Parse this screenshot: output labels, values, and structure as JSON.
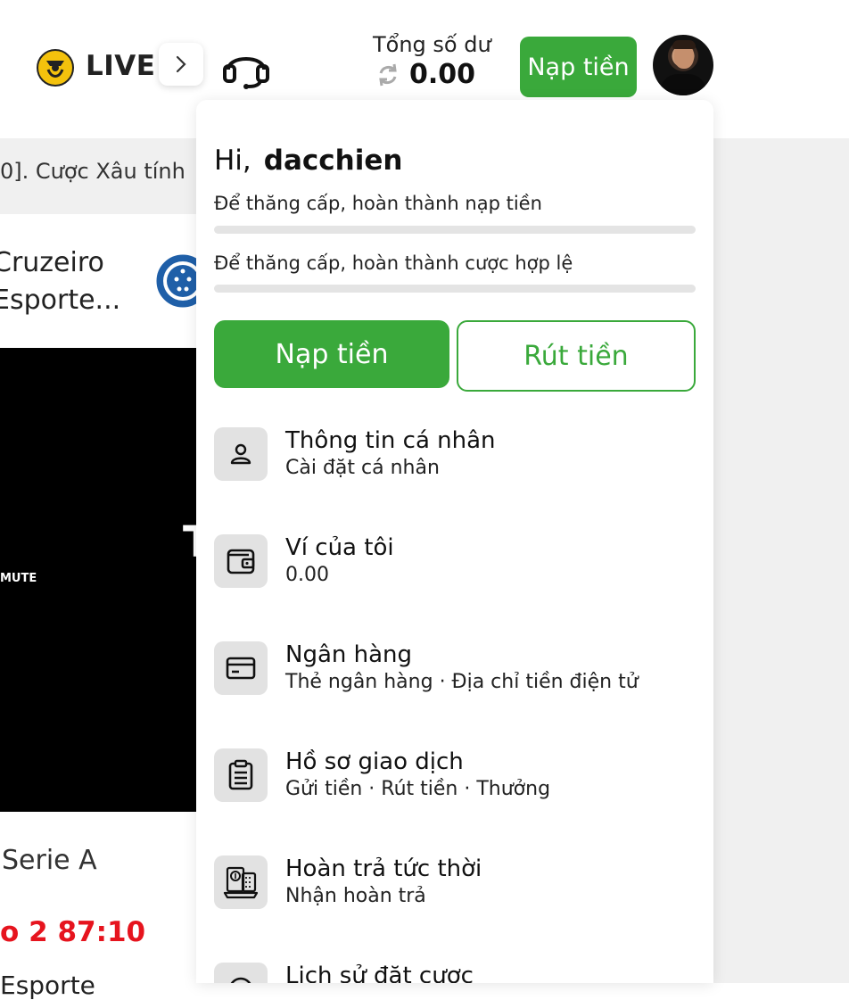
{
  "header": {
    "live_label": "LIVE",
    "balance_label": "Tổng số dư",
    "balance_value": "0.00",
    "deposit_label": "Nạp tiền"
  },
  "background": {
    "ticker": "0]. Cược Xâu tính",
    "team_line1": "Cruzeiro",
    "team_line2": "Esporte...",
    "mute_label": "MUTE",
    "video_text": "T",
    "league": "Serie A",
    "score_time": "o 2 87:10",
    "next_team": "Esporte"
  },
  "panel": {
    "greeting": "Hi,",
    "username": "dacchien",
    "progress": [
      {
        "label": "Để thăng cấp, hoàn thành nạp tiền",
        "value": 0
      },
      {
        "label": "Để thăng cấp, hoàn thành cược hợp lệ",
        "value": 0
      }
    ],
    "deposit_button": "Nạp tiền",
    "withdraw_button": "Rút tiền",
    "menu": [
      {
        "icon": "user-icon",
        "title": "Thông tin cá nhân",
        "subtitle": "Cài đặt cá nhân"
      },
      {
        "icon": "wallet-icon",
        "title": "Ví của tôi",
        "subtitle": "0.00"
      },
      {
        "icon": "card-icon",
        "title": "Ngân hàng",
        "subtitle": "Thẻ ngân hàng · Địa chỉ tiền điện tử"
      },
      {
        "icon": "clipboard-icon",
        "title": "Hồ sơ giao dịch",
        "subtitle": "Gửi tiền · Rút tiền · Thưởng"
      },
      {
        "icon": "rebate-icon",
        "title": "Hoàn trả tức thời",
        "subtitle": "Nhận hoàn trả"
      },
      {
        "icon": "history-icon",
        "title": "Lịch sử đặt cược",
        "subtitle": ""
      }
    ]
  },
  "colors": {
    "accent": "#3aa93b",
    "score": "#e6141e"
  }
}
